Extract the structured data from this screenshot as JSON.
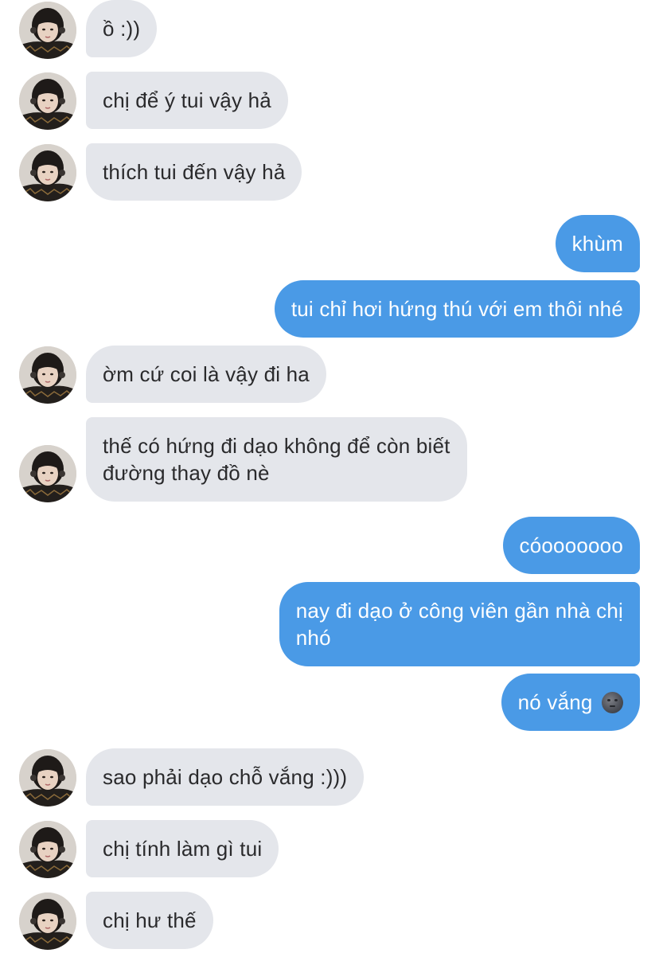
{
  "conversation": {
    "messages": [
      {
        "side": "in",
        "text": "ồ :))"
      },
      {
        "side": "in",
        "text": "chị để ý tui vậy hả"
      },
      {
        "side": "in",
        "text": "thích tui đến vậy hả"
      },
      {
        "side": "out",
        "text": "khùm"
      },
      {
        "side": "out",
        "text": "tui chỉ hơi hứng thú với em thôi nhé"
      },
      {
        "side": "in",
        "text": "ờm cứ coi là vậy đi ha"
      },
      {
        "side": "in",
        "line1": "thế có hứng đi dạo không để còn biết",
        "line2": "đường thay đồ nè"
      },
      {
        "side": "out",
        "text": "cóooooooo"
      },
      {
        "side": "out",
        "line1": "nay đi dạo ở công viên gần nhà chị",
        "line2": "nhó"
      },
      {
        "side": "out",
        "text": "nó vắng",
        "emoji": "new-moon-face-emoji"
      },
      {
        "side": "in",
        "text": "sao phải dạo chỗ vắng :)))"
      },
      {
        "side": "in",
        "text": "chị tính làm gì tui"
      },
      {
        "side": "in",
        "text": "chị hư thế"
      }
    ]
  },
  "colors": {
    "incoming_bubble": "#e4e6eb",
    "outgoing_bubble": "#4a9ae6",
    "incoming_text": "#2a2a2c",
    "outgoing_text": "#ffffff"
  }
}
